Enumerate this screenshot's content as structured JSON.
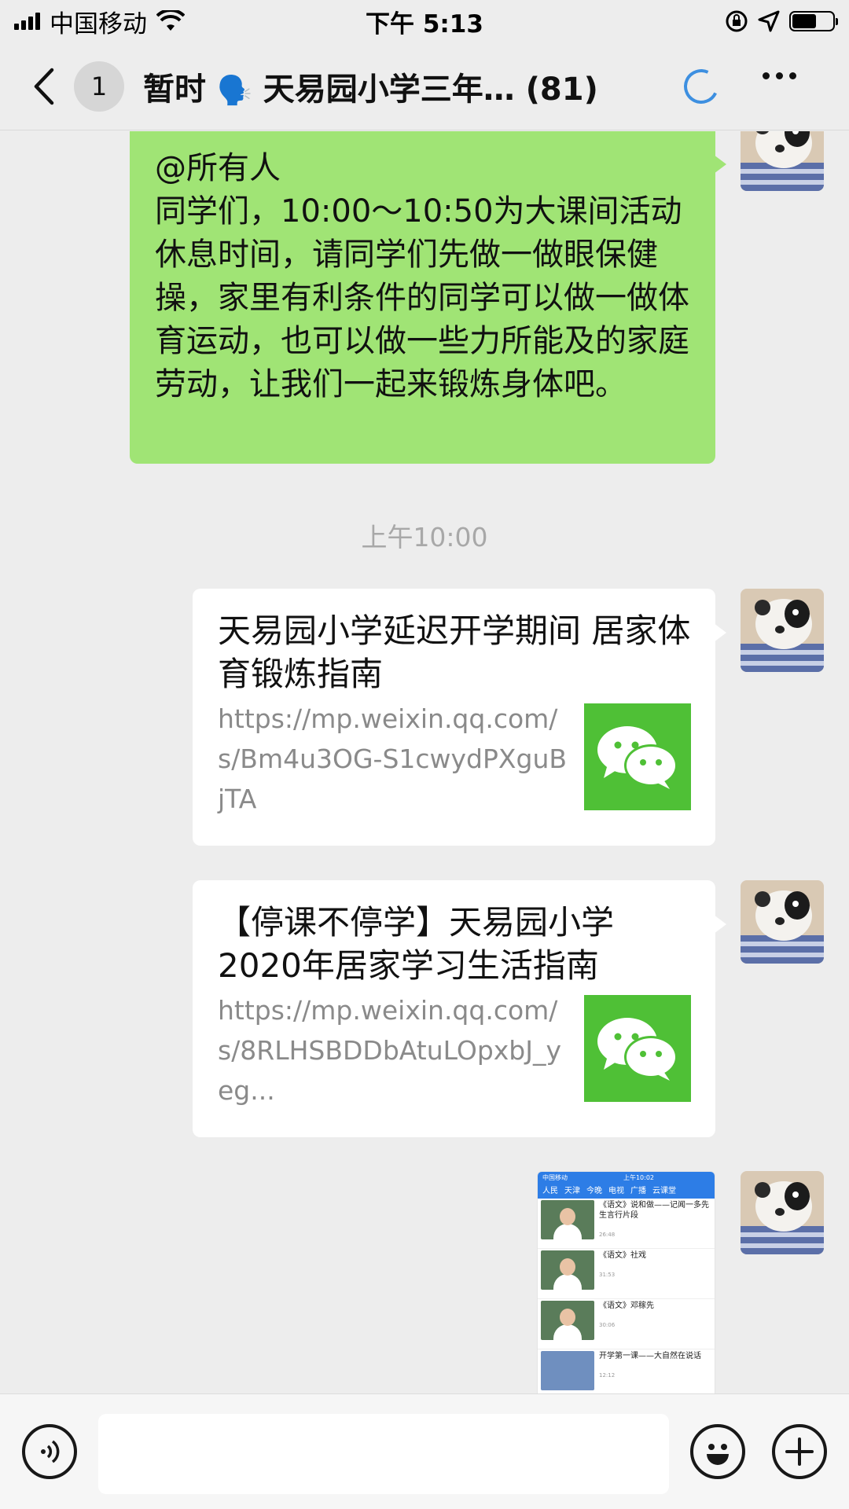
{
  "status_bar": {
    "carrier": "中国移动",
    "time": "下午 5:13"
  },
  "nav": {
    "unread_count": "1",
    "title_prefix": "暂时",
    "title_emoji": "🗣️",
    "title_text": "天易园小学三年…",
    "member_count": "(81)"
  },
  "messages": {
    "announcement": {
      "mention": "@所有人",
      "body": "同学们，10:00～10:50为大课间活动休息时间，请同学们先做一做眼保健操，家里有利条件的同学可以做一做体育运动，也可以做一些力所能及的家庭劳动，让我们一起来锻炼身体吧。"
    },
    "timestamp": "上午10:00",
    "link_cards": [
      {
        "title": "天易园小学延迟开学期间 居家体育锻炼指南",
        "url": "https://mp.weixin.qq.com/s/Bm4u3OG-S1cwydPXguBjTA"
      },
      {
        "title": "【停课不停学】天易园小学2020年居家学习生活指南",
        "url": "https://mp.weixin.qq.com/s/8RLHSBDDbAtuLOpxbJ_yeg..."
      }
    ],
    "image_message": {
      "top_carrier": "中国移动",
      "top_time": "上午10:02",
      "tabs": [
        "人民",
        "天津",
        "今晚",
        "电视",
        "广播",
        "云课堂"
      ],
      "items": [
        {
          "text": "《语文》说和做——记闻一多先生言行片段",
          "duration": "26:48"
        },
        {
          "text": "《语文》社戏",
          "duration": "31:53"
        },
        {
          "text": "《语文》邓稼先",
          "duration": "30:06"
        },
        {
          "text": "开学第一课——大自然在说话",
          "duration": "12:12"
        }
      ]
    }
  },
  "input_bar": {
    "text_value": ""
  },
  "colors": {
    "sent_bubble": "#a0e475",
    "background": "#ededed",
    "wechat_green": "#4fc036",
    "loading_blue": "#3d8fe0"
  }
}
